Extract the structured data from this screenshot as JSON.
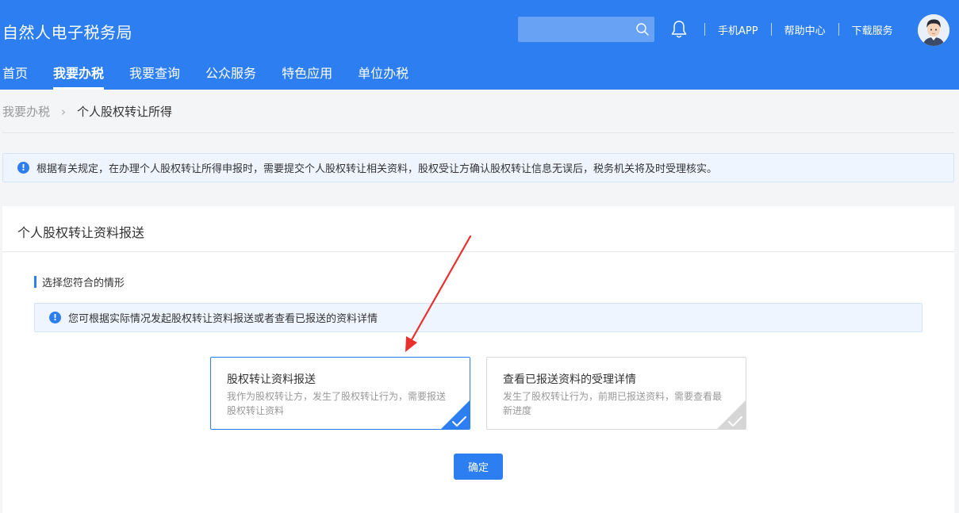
{
  "header": {
    "brand": "自然人电子税务局",
    "search": {
      "placeholder": ""
    },
    "links": [
      "手机APP",
      "帮助中心",
      "下载服务"
    ]
  },
  "nav": {
    "items": [
      "首页",
      "我要办税",
      "我要查询",
      "公众服务",
      "特色应用",
      "单位办税"
    ],
    "active": "我要办税"
  },
  "breadcrumb": {
    "parent": "我要办税",
    "current": "个人股权转让所得"
  },
  "notice": "根据有关规定，在办理个人股权转让所得申报时，需要提交个人股权转让相关资料，股权受让方确认股权转让信息无误后，税务机关将及时受理核实。",
  "card": {
    "title": "个人股权转让资料报送",
    "section_title": "选择您符合的情形",
    "tip": "您可根据实际情况发起股权转让资料报送或者查看已报送的资料详情",
    "options": [
      {
        "title": "股权转让资料报送",
        "desc": "我作为股权转让方，发生了股权转让行为，需要报送股权转让资料",
        "selected": true
      },
      {
        "title": "查看已报送资料的受理详情",
        "desc": "发生了股权转让行为，前期已报送资料，需要查看最新进度",
        "selected": false
      }
    ],
    "confirm_label": "确定"
  },
  "colors": {
    "primary": "#2d7ef0",
    "annotation_arrow": "#e8312d",
    "unselected_corner": "#d6d6d6"
  }
}
